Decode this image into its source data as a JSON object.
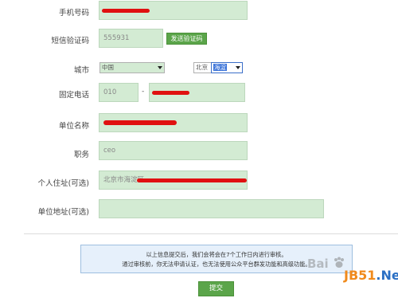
{
  "form": {
    "mobile": {
      "label": "手机号码",
      "value": ""
    },
    "sms_code": {
      "label": "短信验证码",
      "value": "555931",
      "send_button": "发送验证码"
    },
    "city": {
      "label": "城市",
      "country": "中国",
      "province": "北京",
      "district": "海淀"
    },
    "landline": {
      "label": "固定电话",
      "area_code": "010",
      "separator": "-",
      "number": ""
    },
    "company": {
      "label": "单位名称",
      "value": ""
    },
    "position": {
      "label": "职务",
      "value": "ceo"
    },
    "home_address": {
      "label": "个人住址(可选)",
      "value": "北京市海淀区"
    },
    "company_address": {
      "label": "单位地址(可选)",
      "value": ""
    }
  },
  "notice": {
    "line1": "以上信息提交后，我们会将会在7个工作日内进行审核。",
    "line2": "通过审核前，你无法申请认证，也无法使用公众平台群发功能和高级功能。"
  },
  "submit_label": "提交",
  "watermark": {
    "baidu_text": "Bai",
    "jb51_j": "J",
    "jb51_b": "B51",
    "jb51_net": ".Net"
  },
  "colors": {
    "input_bg": "#d3ebd3",
    "button_green": "#5ba54a",
    "redaction": "#e01010",
    "notice_bg": "#e6f0fb"
  }
}
